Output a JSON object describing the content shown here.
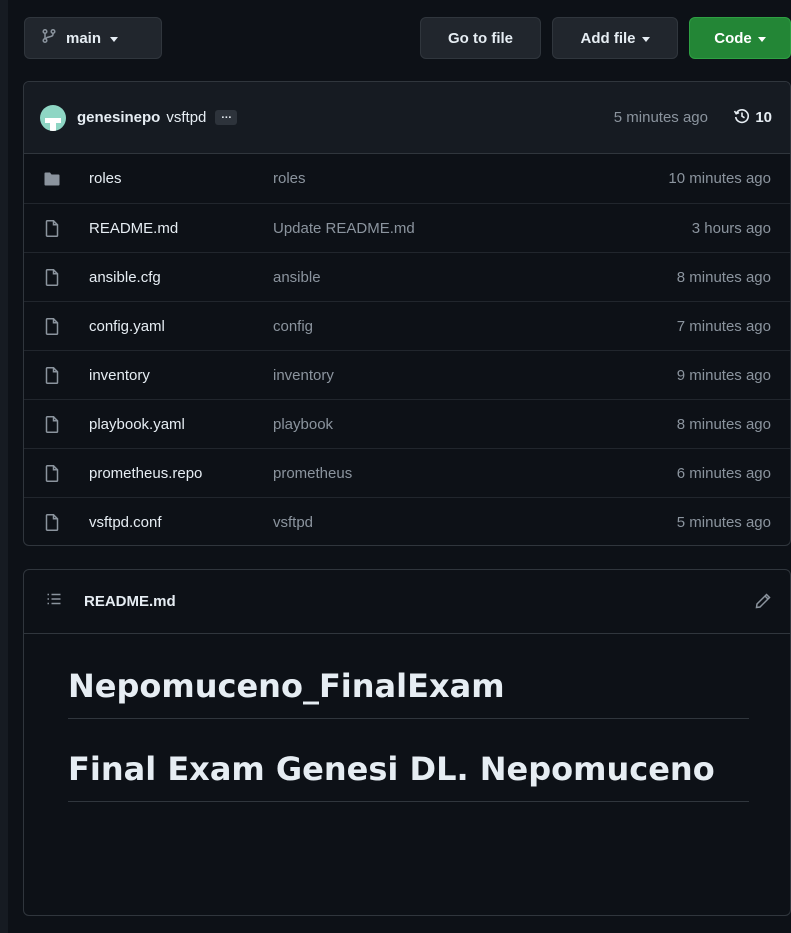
{
  "toolbar": {
    "branch": "main",
    "go_to_file": "Go to file",
    "add_file": "Add file",
    "code": "Code"
  },
  "latest_commit": {
    "author": "genesinepo",
    "message": "vsftpd",
    "ellipsis": "…",
    "time": "5 minutes ago",
    "history_count": "10"
  },
  "files": [
    {
      "type": "folder",
      "name": "roles",
      "message": "roles",
      "time": "10 minutes ago"
    },
    {
      "type": "file",
      "name": "README.md",
      "message": "Update README.md",
      "time": "3 hours ago"
    },
    {
      "type": "file",
      "name": "ansible.cfg",
      "message": "ansible",
      "time": "8 minutes ago"
    },
    {
      "type": "file",
      "name": "config.yaml",
      "message": "config",
      "time": "7 minutes ago"
    },
    {
      "type": "file",
      "name": "inventory",
      "message": "inventory",
      "time": "9 minutes ago"
    },
    {
      "type": "file",
      "name": "playbook.yaml",
      "message": "playbook",
      "time": "8 minutes ago"
    },
    {
      "type": "file",
      "name": "prometheus.repo",
      "message": "prometheus",
      "time": "6 minutes ago"
    },
    {
      "type": "file",
      "name": "vsftpd.conf",
      "message": "vsftpd",
      "time": "5 minutes ago"
    }
  ],
  "readme": {
    "filename": "README.md",
    "heading1": "Nepomuceno_FinalExam",
    "heading2": "Final Exam Genesi DL. Nepomuceno"
  },
  "colors": {
    "background": "#0d1117",
    "header_background": "#161b22",
    "border": "#30363d",
    "code_button": "#238636",
    "muted_text": "#8b949e"
  }
}
